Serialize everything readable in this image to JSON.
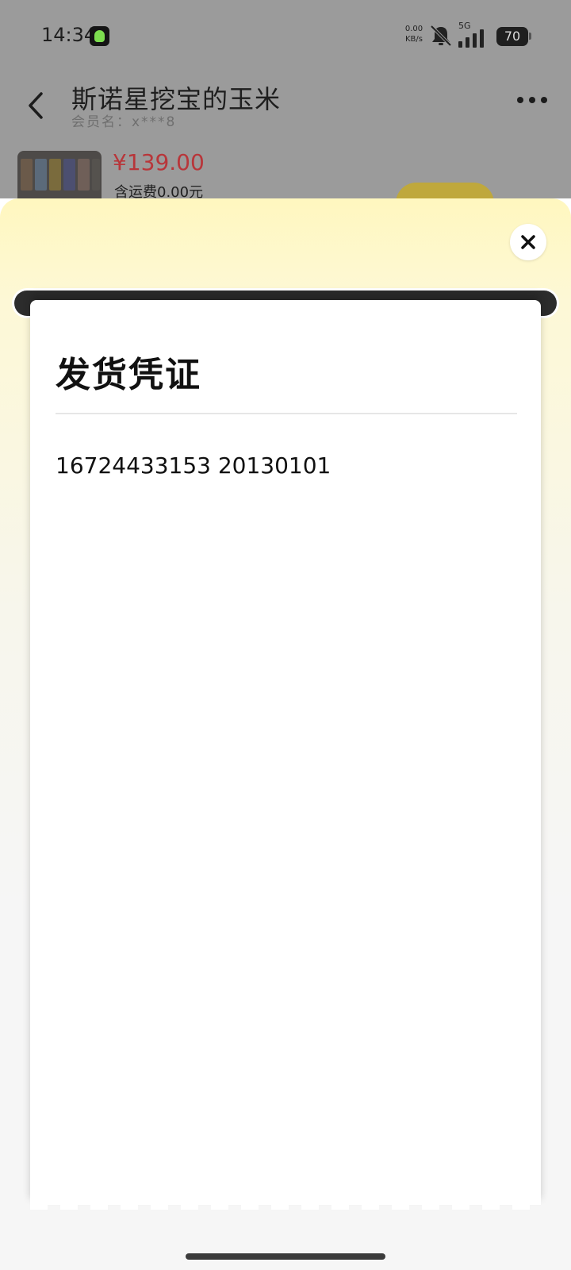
{
  "status_bar": {
    "time": "14:34",
    "net_speed_value": "0.00",
    "net_speed_unit": "KB/s",
    "network_type": "5G",
    "battery": "70"
  },
  "header": {
    "shop_name": "斯诺星挖宝的玉米",
    "member_label": "会员名：x***8"
  },
  "product": {
    "price": "¥139.00",
    "shipping": "含运费0.00元"
  },
  "voucher": {
    "title": "发货凭证",
    "content": "16724433153 20130101"
  },
  "colors": {
    "price": "#b8363a",
    "sheet_top": "#fff7bf",
    "dim_overlay": "#9b9b9b"
  },
  "icons": {
    "back": "chevron-left-icon",
    "more": "more-dots-icon",
    "close": "close-icon",
    "mute": "bell-off-icon",
    "signal": "signal-bars-icon",
    "battery": "battery-icon"
  }
}
